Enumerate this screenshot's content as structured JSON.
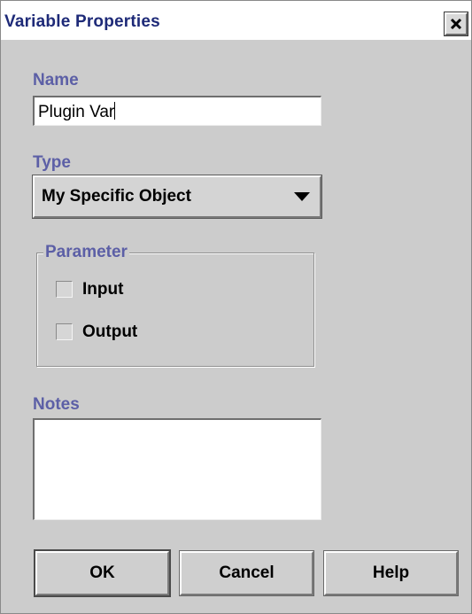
{
  "window": {
    "title": "Variable Properties",
    "close_icon": "close-icon"
  },
  "name": {
    "label": "Name",
    "value": "Plugin Var"
  },
  "type": {
    "label": "Type",
    "selected": "My Specific Object",
    "arrow_icon": "chevron-down-icon"
  },
  "parameter": {
    "title": "Parameter",
    "options": [
      {
        "label": "Input",
        "checked": false
      },
      {
        "label": "Output",
        "checked": false
      }
    ]
  },
  "notes": {
    "label": "Notes",
    "value": ""
  },
  "buttons": {
    "ok": "OK",
    "cancel": "Cancel",
    "help": "Help"
  },
  "colors": {
    "title_text": "#1e2a78",
    "label_text": "#5c5fa6",
    "dialog_bg": "#cccccc"
  }
}
